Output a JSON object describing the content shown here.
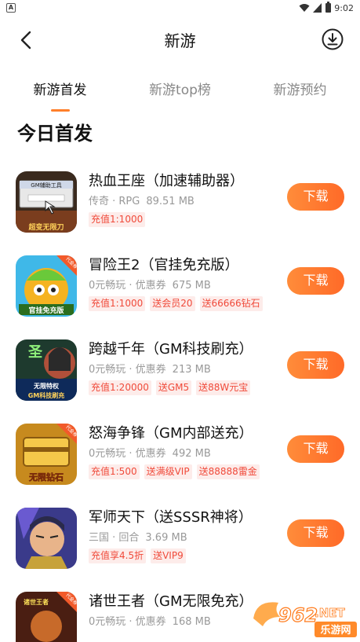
{
  "status_bar": {
    "time": "9:02",
    "left_icon": "A"
  },
  "header": {
    "title": "新游",
    "back_icon": "back-arrow-icon",
    "download_icon": "download-circle-icon"
  },
  "tabs": [
    {
      "label": "新游首发",
      "active": true
    },
    {
      "label": "新游top榜",
      "active": false
    },
    {
      "label": "新游预约",
      "active": false
    }
  ],
  "section": {
    "title": "今日首发"
  },
  "games": [
    {
      "name": "热血王座（加速辅助器）",
      "category": "传奇 · RPG",
      "size": "89.51 MB",
      "tags": [
        "充值1:1000"
      ],
      "button": "下载"
    },
    {
      "name": "冒险王2（官挂免充版）",
      "category": "0元畅玩 · 优惠券",
      "size": "675 MB",
      "tags": [
        "充值1:1000",
        "送会员20",
        "送66666钻石"
      ],
      "button": "下载"
    },
    {
      "name": "跨越千年（GM科技刷充）",
      "category": "0元畅玩 · 优惠券",
      "size": "213 MB",
      "tags": [
        "充值1:20000",
        "送GM5",
        "送88W元宝"
      ],
      "button": "下载"
    },
    {
      "name": "怒海争锋（GM内部送充）",
      "category": "0元畅玩 · 优惠券",
      "size": "492 MB",
      "tags": [
        "充值1:500",
        "送满级VIP",
        "送88888雷金"
      ],
      "button": "下载"
    },
    {
      "name": "军师天下（送SSSR神将）",
      "category": "三国 · 回合",
      "size": "3.69 MB",
      "tags": [
        "充值享4.5折",
        "送VIP9"
      ],
      "button": "下载"
    },
    {
      "name": "诸世王者（GM无限免充）",
      "category": "0元畅玩 · 优惠券",
      "size": "168 MB",
      "tags": [],
      "button": "下载"
    }
  ],
  "icon_texts": [
    "GM辅助工具",
    "超变无限刀",
    "代金券",
    "官挂免充版",
    "圣",
    "无限特权",
    "GM科技刷充",
    "代金券",
    "无限钻石",
    "诸世王者",
    "代金券"
  ],
  "watermark": {
    "text1": "962",
    "text2": ".NET",
    "text3": "乐游网"
  },
  "colors": {
    "accent": "#ff7f2a",
    "button_start": "#ff8c3a",
    "button_end": "#ff6a28",
    "tag_text": "#f04a3a",
    "tag_bg": "#fdecea"
  }
}
